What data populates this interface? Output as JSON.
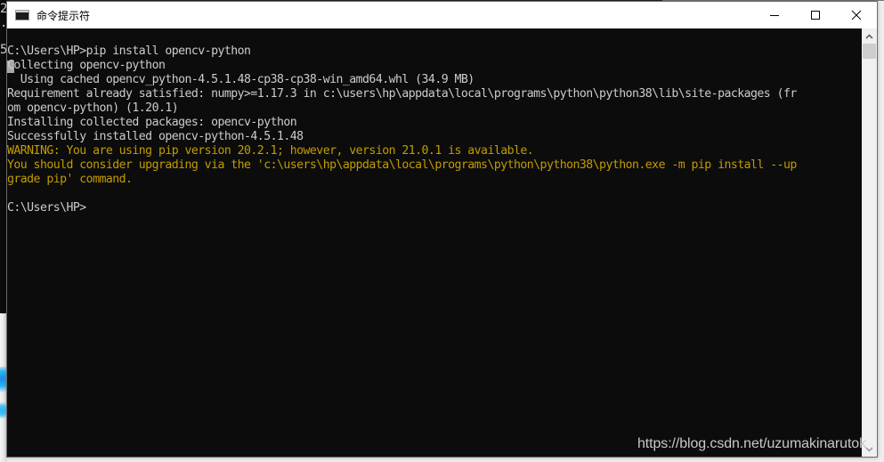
{
  "window": {
    "title": "命令提示符",
    "app_icon_label": "C:\\_",
    "controls": {
      "minimize": "minimize-icon",
      "maximize": "maximize-icon",
      "close": "close-icon"
    }
  },
  "background": {
    "left_chars": [
      "2",
      ".",
      "5"
    ]
  },
  "console": {
    "colors": {
      "background": "#0c0c0c",
      "text": "#cccccc",
      "warning": "#c19c00"
    },
    "lines": [
      {
        "text": "C:\\Users\\HP>pip install opencv-python",
        "color": "white"
      },
      {
        "text": "Collecting opencv-python",
        "color": "white"
      },
      {
        "text": "  Using cached opencv_python-4.5.1.48-cp38-cp38-win_amd64.whl (34.9 MB)",
        "color": "white"
      },
      {
        "text": "Requirement already satisfied: numpy>=1.17.3 in c:\\users\\hp\\appdata\\local\\programs\\python\\python38\\lib\\site-packages (fr",
        "color": "white"
      },
      {
        "text": "om opencv-python) (1.20.1)",
        "color": "white"
      },
      {
        "text": "Installing collected packages: opencv-python",
        "color": "white"
      },
      {
        "text": "Successfully installed opencv-python-4.5.1.48",
        "color": "white"
      },
      {
        "text": "WARNING: You are using pip version 20.2.1; however, version 21.0.1 is available.",
        "color": "yellow"
      },
      {
        "text": "You should consider upgrading via the 'c:\\users\\hp\\appdata\\local\\programs\\python\\python38\\python.exe -m pip install --up",
        "color": "yellow"
      },
      {
        "text": "grade pip' command.",
        "color": "yellow"
      },
      {
        "text": "",
        "color": "white"
      },
      {
        "text": "C:\\Users\\HP>",
        "color": "white"
      }
    ]
  },
  "scrollbar": {
    "up_icon": "chevron-up-icon",
    "down_icon": "chevron-down-icon"
  },
  "watermark": "https://blog.csdn.net/uzumakinarutok"
}
